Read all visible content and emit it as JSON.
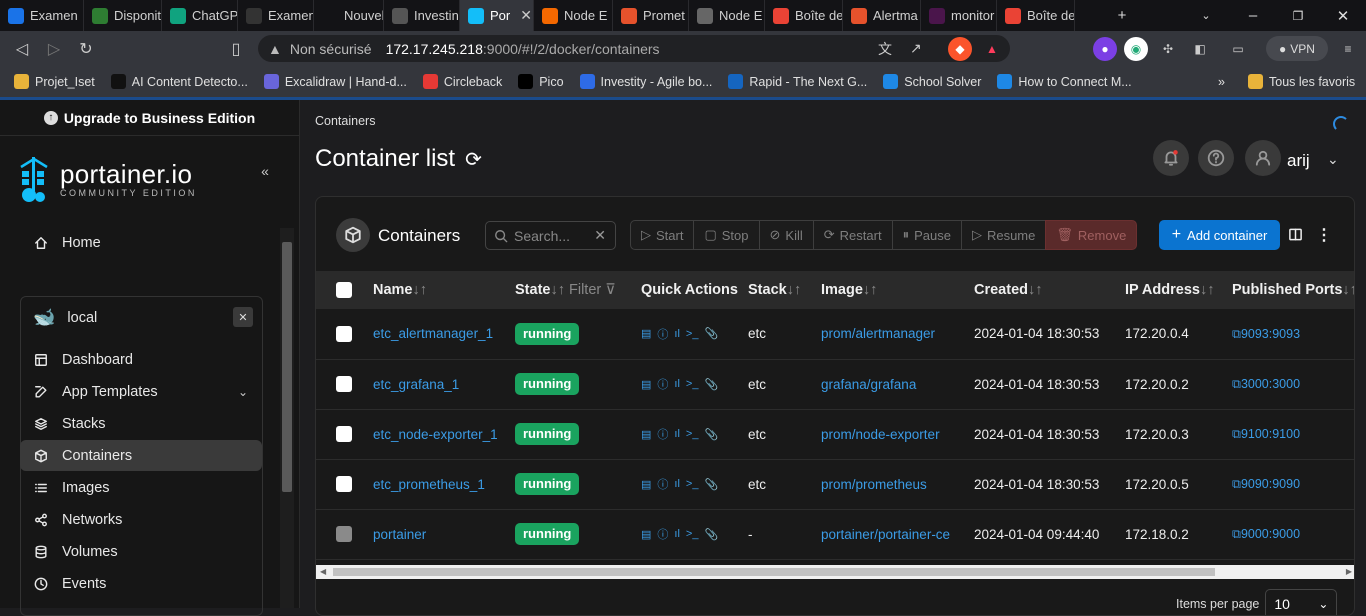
{
  "browser": {
    "tabs": [
      {
        "label": "Examen",
        "color": "#1a73e8"
      },
      {
        "label": "Disponit",
        "color": "#2e7d32"
      },
      {
        "label": "ChatGP",
        "color": "#10a37f"
      },
      {
        "label": "Examen",
        "color": "#333333"
      },
      {
        "label": "Nouvel ong",
        "color": "#00000000"
      },
      {
        "label": "Investin",
        "color": "#555555"
      },
      {
        "label": "Por",
        "color": "#13bef9"
      },
      {
        "label": "Node E",
        "color": "#f46800"
      },
      {
        "label": "Promet",
        "color": "#e6522c"
      },
      {
        "label": "Node E",
        "color": "#666666"
      },
      {
        "label": "Boîte de",
        "color": "#ea4335"
      },
      {
        "label": "Alertma",
        "color": "#e6522c"
      },
      {
        "label": "monitor",
        "color": "#4a154b"
      },
      {
        "label": "Boîte de",
        "color": "#ea4335"
      }
    ],
    "address": {
      "security": "Non sécurisé",
      "host": "172.17.245.218",
      "path": ":9000/#!/2/docker/containers"
    },
    "vpn_label": "VPN",
    "bookmarks": [
      {
        "label": "Projet_Iset",
        "color": "#e8b33a"
      },
      {
        "label": "AI Content Detecto...",
        "color": "#111111"
      },
      {
        "label": "Excalidraw | Hand-d...",
        "color": "#6965db"
      },
      {
        "label": "Circleback",
        "color": "#e53935"
      },
      {
        "label": "Pico",
        "color": "#000000"
      },
      {
        "label": "Investity - Agile bo...",
        "color": "#2e6be6"
      },
      {
        "label": "Rapid - The Next G...",
        "color": "#1565c0"
      },
      {
        "label": "School Solver",
        "color": "#1e88e5"
      },
      {
        "label": "How to Connect M...",
        "color": "#1e88e5"
      }
    ],
    "more_bookmarks": "»",
    "all_favorites": "Tous les favoris"
  },
  "sidebar": {
    "upgrade": "Upgrade to Business Edition",
    "logo_text": "portainer.io",
    "logo_sub": "COMMUNITY EDITION",
    "home": "Home",
    "environment": "local",
    "items": [
      {
        "label": "Dashboard",
        "icon": "dashboard-icon"
      },
      {
        "label": "App Templates",
        "icon": "edit-icon"
      },
      {
        "label": "Stacks",
        "icon": "layers-icon"
      },
      {
        "label": "Containers",
        "icon": "box-icon"
      },
      {
        "label": "Images",
        "icon": "list-icon"
      },
      {
        "label": "Networks",
        "icon": "share-icon"
      },
      {
        "label": "Volumes",
        "icon": "database-icon"
      },
      {
        "label": "Events",
        "icon": "clock-icon"
      }
    ]
  },
  "header": {
    "breadcrumb": "Containers",
    "title": "Container list",
    "user": "arij"
  },
  "card": {
    "title": "Containers",
    "search_placeholder": "Search...",
    "actions": [
      "Start",
      "Stop",
      "Kill",
      "Restart",
      "Pause",
      "Resume",
      "Remove"
    ],
    "add_label": "Add container"
  },
  "table": {
    "columns": [
      "Name",
      "State",
      "Filter",
      "Quick Actions",
      "Stack",
      "Image",
      "Created",
      "IP Address",
      "Published Ports"
    ],
    "rows": [
      {
        "name": "etc_alertmanager_1",
        "state": "running",
        "stack": "etc",
        "image": "prom/alertmanager",
        "created": "2024-01-04 18:30:53",
        "ip": "172.20.0.4",
        "ports": "9093:9093",
        "disabled": false
      },
      {
        "name": "etc_grafana_1",
        "state": "running",
        "stack": "etc",
        "image": "grafana/grafana",
        "created": "2024-01-04 18:30:53",
        "ip": "172.20.0.2",
        "ports": "3000:3000",
        "disabled": false
      },
      {
        "name": "etc_node-exporter_1",
        "state": "running",
        "stack": "etc",
        "image": "prom/node-exporter",
        "created": "2024-01-04 18:30:53",
        "ip": "172.20.0.3",
        "ports": "9100:9100",
        "disabled": false
      },
      {
        "name": "etc_prometheus_1",
        "state": "running",
        "stack": "etc",
        "image": "prom/prometheus",
        "created": "2024-01-04 18:30:53",
        "ip": "172.20.0.5",
        "ports": "9090:9090",
        "disabled": false
      },
      {
        "name": "portainer",
        "state": "running",
        "stack": "-",
        "image": "portainer/portainer-ce",
        "created": "2024-01-04 09:44:40",
        "ip": "172.18.0.2",
        "ports": "9000:9000",
        "disabled": true
      }
    ]
  },
  "pagination": {
    "label": "Items per page",
    "value": "10"
  }
}
